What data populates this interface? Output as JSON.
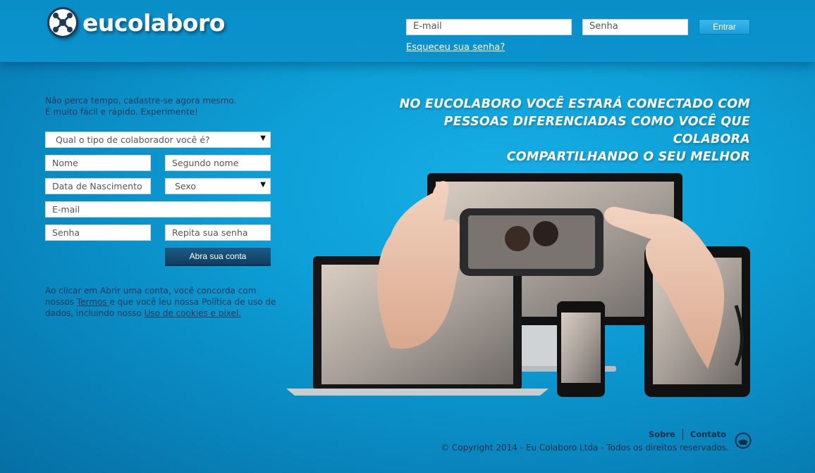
{
  "brand": {
    "name": "eucolaboro"
  },
  "login": {
    "email_placeholder": "E-mail",
    "password_placeholder": "Senha",
    "submit_label": "Entrar",
    "forgot_label": "Esqueceu sua senha?"
  },
  "signup": {
    "intro_line1": "Não perca tempo, cadastre-se agora mesmo.",
    "intro_line2": "É muito fácil e rápido. Experimente!",
    "type_select": "Qual o tipo de colaborador você é?",
    "first_name": "Nome",
    "second_name": "Segundo nome",
    "birth_date": "Data de Nascimento",
    "sex_select": "Sexo",
    "email": "E-mail",
    "password": "Senha",
    "repeat_password": "Repita sua senha",
    "submit_label": "Abra sua conta",
    "terms_part1": "Ao clicar em Abrir uma conta, você concorda com nossos ",
    "terms_link": "Termos ",
    "terms_part2": "e que você leu nossa Política de uso de dados, incluindo nosso ",
    "cookies_link": "Uso de cookies e pixel."
  },
  "hero": {
    "headline_line1": "NO EUCOLABORO VOCÊ ESTARÁ CONECTADO COM",
    "headline_line2": "PESSOAS DIFERENCIADAS COMO VOCÊ QUE COLABORA",
    "headline_line3": "COMPARTILHANDO O SEU MELHOR"
  },
  "footer": {
    "about_label": "Sobre",
    "contact_label": "Contato",
    "copyright": "© Copyright 2014 - Eu Colaboro Ltda - Todos os direitos reservados."
  },
  "colors": {
    "background": "#0d9fd6",
    "dark_text": "#143a5a",
    "signup_button": "#0f3f63",
    "login_button": "#1d9fd8"
  }
}
